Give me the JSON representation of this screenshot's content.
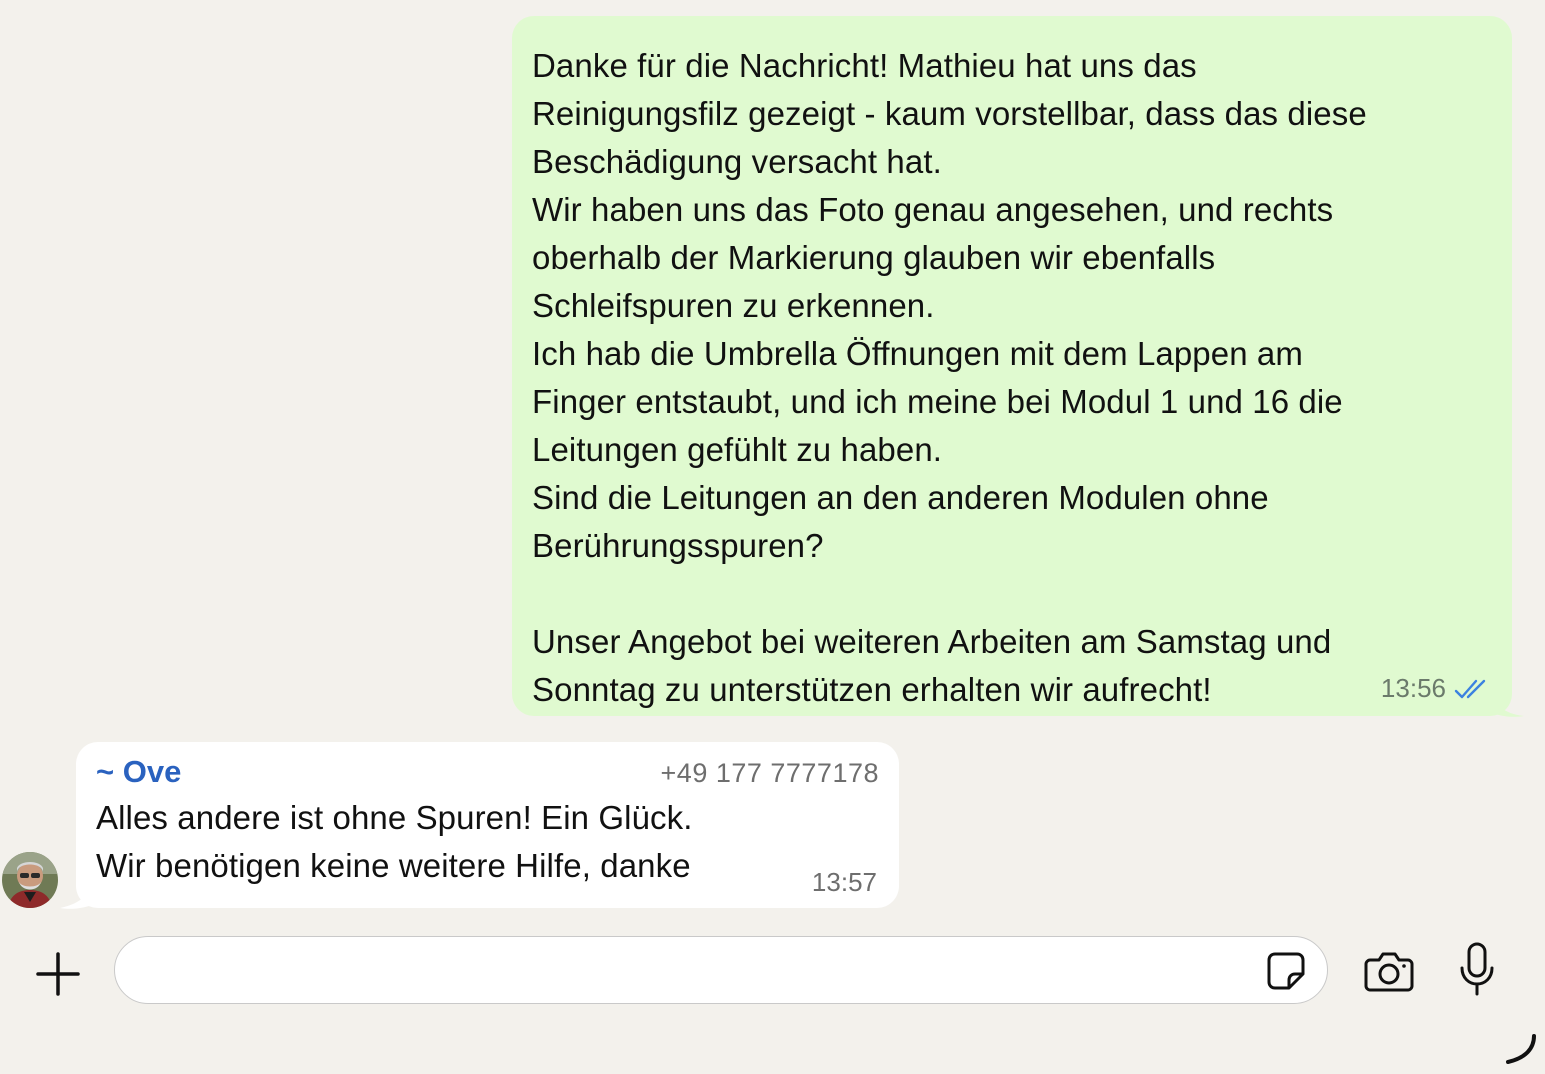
{
  "messages": {
    "outgoing": {
      "text": "Danke für die Nachricht! Mathieu hat uns das\nReinigungsfilz gezeigt - kaum vorstellbar, dass das diese\nBeschädigung versacht hat.\nWir haben uns das Foto genau angesehen, und rechts\noberhalb der Markierung glauben wir ebenfalls\nSchleifspuren zu erkennen.\nIch hab die Umbrella Öffnungen mit dem Lappen am\nFinger entstaubt, und ich meine bei Modul 1 und 16 die\nLeitungen gefühlt zu haben.\nSind die Leitungen an den anderen Modulen ohne\nBerührungsspuren?\n\nUnser Angebot bei weiteren Arbeiten am Samstag und\nSonntag zu unterstützen erhalten wir aufrecht!",
      "time": "13:56",
      "status_icon": "double-check-read-icon"
    },
    "incoming": {
      "sender": "~ Ove",
      "phone": "+49 177 7777178",
      "text": "Alles andere ist ohne Spuren! Ein Glück.\nWir benötigen keine weitere Hilfe, danke",
      "time": "13:57",
      "avatar_icon": "user-avatar"
    }
  },
  "composer": {
    "placeholder": "",
    "value": "",
    "icons": [
      "plus-icon",
      "sticker-icon",
      "camera-icon",
      "microphone-icon"
    ]
  },
  "colors": {
    "background": "#f3f1ec",
    "outgoing_bubble": "#e0fad0",
    "incoming_bubble": "#ffffff",
    "sender_name": "#2a62bf",
    "read_ticks": "#3b82e0"
  }
}
